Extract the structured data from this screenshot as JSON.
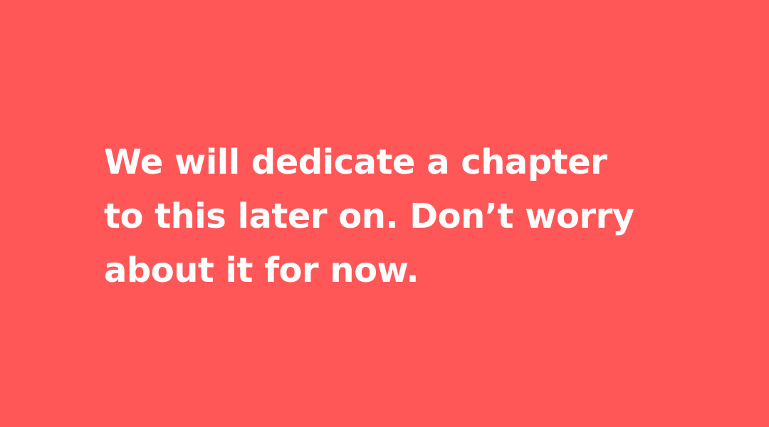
{
  "slide": {
    "background_color": "#ff5757",
    "text_color": "#ffffff",
    "lines": [
      "We will dedicate a chapter",
      "to this later on. Don’t worry",
      "about it for now."
    ]
  }
}
